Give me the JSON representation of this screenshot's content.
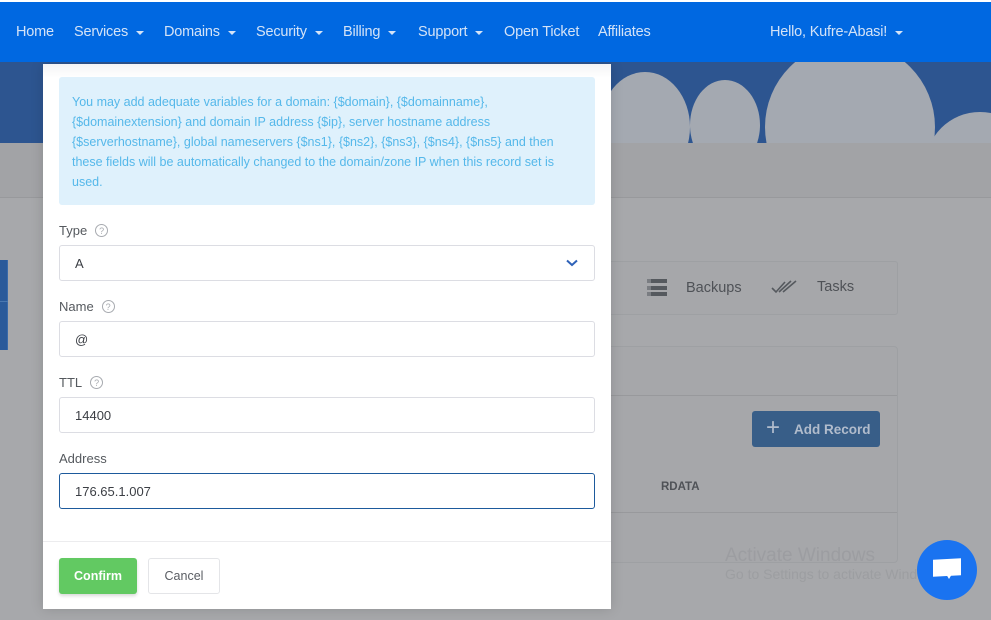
{
  "nav": {
    "items": [
      {
        "label": "Home",
        "dropdown": false
      },
      {
        "label": "Services",
        "dropdown": true
      },
      {
        "label": "Domains",
        "dropdown": true
      },
      {
        "label": "Security",
        "dropdown": true
      },
      {
        "label": "Billing",
        "dropdown": true
      },
      {
        "label": "Support",
        "dropdown": true
      },
      {
        "label": "Open Ticket",
        "dropdown": false
      },
      {
        "label": "Affiliates",
        "dropdown": false
      }
    ],
    "user_greeting": "Hello, Kufre-Abasi!",
    "color": "#0068e1"
  },
  "background_page": {
    "tabs": [
      {
        "label": "Backups",
        "icon": "server-icon"
      },
      {
        "label": "Tasks",
        "icon": "double-check-icon"
      }
    ],
    "add_record_label": "Add Record",
    "table_header_rdata": "RDATA",
    "watermark_line1": "Activate Windows",
    "watermark_line2": "Go to Settings to activate Windows."
  },
  "modal": {
    "info_text": "You may add adequate variables for a domain: {$domain}, {$domainname}, {$domainextension} and domain IP address {$ip}, server hostname address {$serverhostname}, global nameservers {$ns1}, {$ns2}, {$ns3}, {$ns4}, {$ns5} and then these fields will be automatically changed to the domain/zone IP when this record set is used.",
    "fields": {
      "type": {
        "label": "Type",
        "value": "A",
        "help": "?"
      },
      "name": {
        "label": "Name",
        "value": "@",
        "help": "?"
      },
      "ttl": {
        "label": "TTL",
        "value": "14400",
        "help": "?"
      },
      "address": {
        "label": "Address",
        "value": "176.65.1.007"
      }
    },
    "confirm_label": "Confirm",
    "cancel_label": "Cancel",
    "confirm_color": "#62c962"
  },
  "chat": {
    "icon": "chat-icon",
    "color": "#1a73f0"
  }
}
